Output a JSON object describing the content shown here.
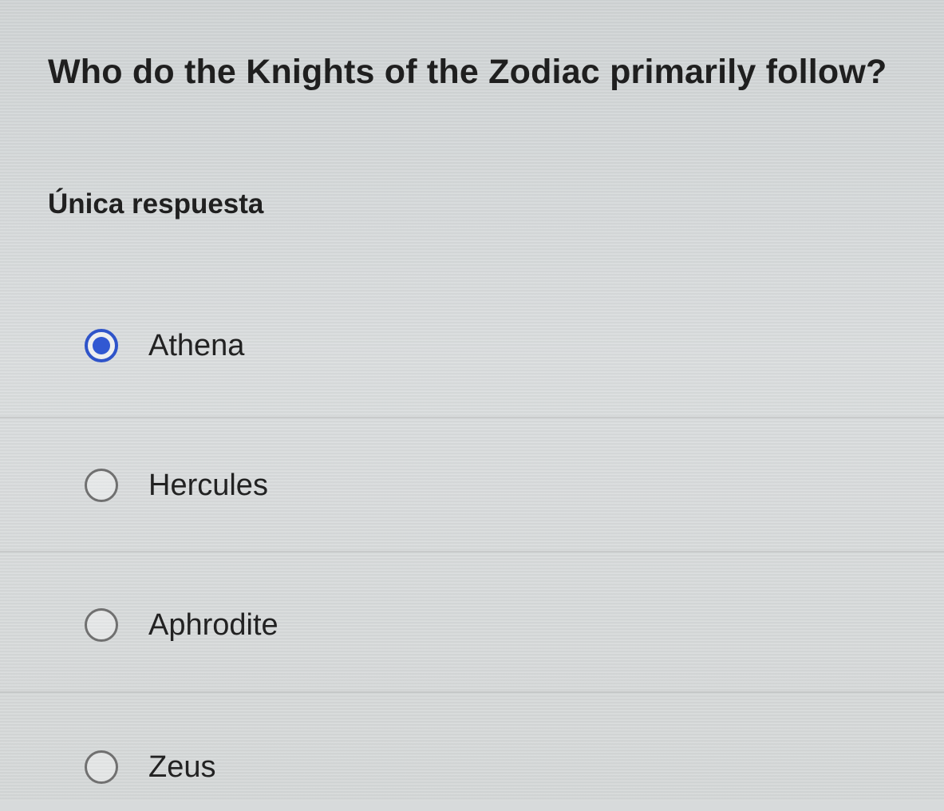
{
  "question": {
    "text": "Who do the Knights of the Zodiac primarily follow?"
  },
  "answer_type": {
    "label": "Única respuesta"
  },
  "options": [
    {
      "label": "Athena",
      "selected": true
    },
    {
      "label": "Hercules",
      "selected": false
    },
    {
      "label": "Aphrodite",
      "selected": false
    },
    {
      "label": "Zeus",
      "selected": false
    }
  ],
  "colors": {
    "selected_radio": "#3158d2",
    "text": "#222222",
    "background": "#d7dadb"
  }
}
